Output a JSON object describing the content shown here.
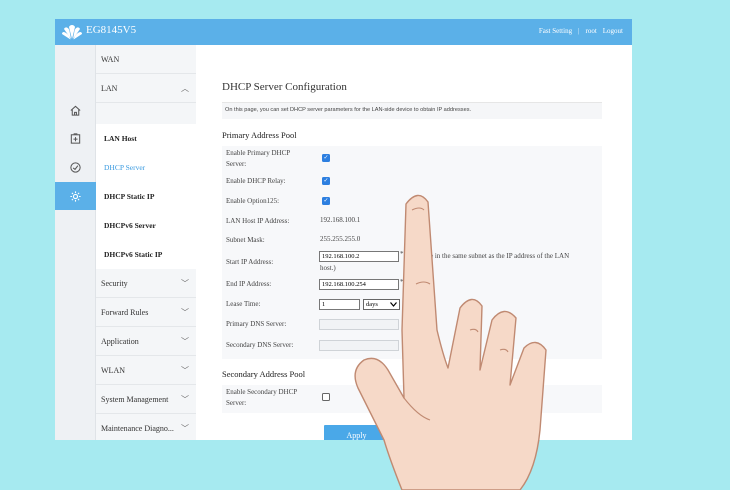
{
  "topbar": {
    "brand": "EG8145V5",
    "links": [
      "Fast Setting",
      "root",
      "Logout"
    ],
    "separator": "|"
  },
  "menu": {
    "items": [
      {
        "label": "WAN"
      },
      {
        "label": "LAN",
        "chevron": "up"
      },
      {
        "label": "Security",
        "chevron": "down"
      },
      {
        "label": "Forward Rules",
        "chevron": "down"
      },
      {
        "label": "Application",
        "chevron": "down"
      },
      {
        "label": "WLAN",
        "chevron": "down"
      },
      {
        "label": "System Management",
        "chevron": "down"
      },
      {
        "label": "Maintenance Diagno...",
        "chevron": "down"
      }
    ],
    "lan_subitems": [
      "LAN Host",
      "DHCP Server",
      "DHCP Static IP",
      "DHCPv6 Server",
      "DHCPv6 Static IP"
    ],
    "active_subitem": "DHCP Server"
  },
  "rail_icons": [
    "home-icon",
    "add-box-icon",
    "gauge-icon",
    "settings-icon"
  ],
  "page": {
    "title": "DHCP Server Configuration",
    "description": "On this page, you can set DHCP server parameters for the LAN-side device to obtain IP addresses."
  },
  "primary": {
    "title": "Primary Address Pool",
    "enable_label_1": "Enable Primary DHCP",
    "enable_label_2": "Server:",
    "relay_label": "Enable DHCP Relay:",
    "option125_label": "Enable Option125:",
    "lan_ip_label": "LAN Host IP Address:",
    "lan_ip_value": "192.168.100.1",
    "mask_label": "Subnet Mask:",
    "mask_value": "255.255.255.0",
    "start_label": "Start IP Address:",
    "start_value": "192.168.100.2",
    "start_hint_1": "e in the same subnet as the IP address of the LAN",
    "start_hint_2": "host.)",
    "end_label": "End IP Address:",
    "end_value": "192.168.100.254",
    "lease_label": "Lease Time:",
    "lease_value": "1",
    "lease_unit": "days",
    "dns1_label": "Primary DNS Server:",
    "dns2_label": "Secondary DNS Server:",
    "required_mark": "*"
  },
  "secondary": {
    "title": "Secondary Address Pool",
    "enable_label_1": "Enable Secondary DHCP",
    "enable_label_2": "Server:"
  },
  "apply_label": "Apply",
  "colors": {
    "accent": "#5bb0e8",
    "checkbox": "#2d7fe0",
    "background": "#a6eaf0"
  }
}
